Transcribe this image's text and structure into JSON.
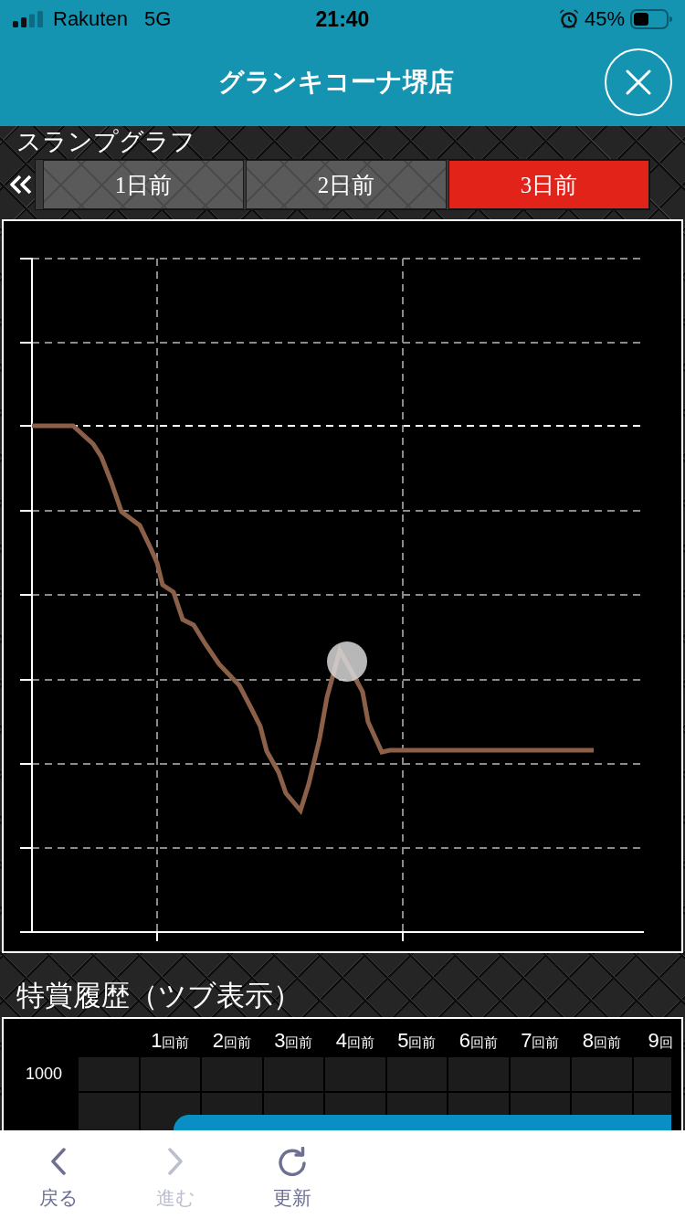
{
  "status_bar": {
    "carrier": "Rakuten",
    "network": "5G",
    "time": "21:40",
    "battery": "45%"
  },
  "header": {
    "title": "グランキコーナ堺店"
  },
  "slump_title": "スランプグラフ",
  "day_tabs": [
    {
      "label": "1日前",
      "selected": false
    },
    {
      "label": "2日前",
      "selected": false
    },
    {
      "label": "3日前",
      "selected": true
    }
  ],
  "history": {
    "title": "特賞履歴（ツブ表示）",
    "columns": [
      {
        "number": "1",
        "unit": "回前"
      },
      {
        "number": "2",
        "unit": "回前"
      },
      {
        "number": "3",
        "unit": "回前"
      },
      {
        "number": "4",
        "unit": "回前"
      },
      {
        "number": "5",
        "unit": "回前"
      },
      {
        "number": "6",
        "unit": "回前"
      },
      {
        "number": "7",
        "unit": "回前"
      },
      {
        "number": "8",
        "unit": "回前"
      },
      {
        "number": "9",
        "unit": "回"
      }
    ],
    "row_labels": [
      "1000"
    ]
  },
  "toolbar": [
    {
      "kind": "back",
      "label": "戻る",
      "disabled": false
    },
    {
      "kind": "forward",
      "label": "進む",
      "disabled": true
    },
    {
      "kind": "reload",
      "label": "更新",
      "disabled": false
    }
  ]
}
